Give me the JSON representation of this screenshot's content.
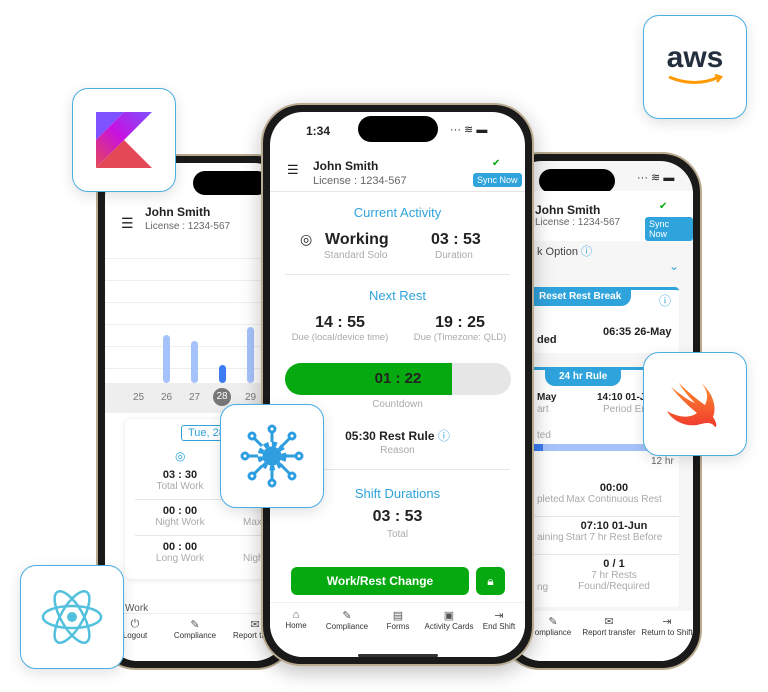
{
  "status": {
    "time": "1:34"
  },
  "user": {
    "name": "John Smith",
    "license": "License : 1234-567",
    "sync_label": "Sync Now"
  },
  "center": {
    "current_activity_title": "Current Activity",
    "activity": "Working",
    "activity_sub": "Standard Solo",
    "duration": "03 : 53",
    "duration_label": "Duration",
    "next_rest_title": "Next Rest",
    "due_local": "14 : 55",
    "due_local_label": "Due (local/device time)",
    "due_tz": "19 : 25",
    "due_tz_label": "Due (Timezone: QLD)",
    "countdown": "01 : 22",
    "countdown_label": "Countdown",
    "countdown_progress_percent": 74,
    "rule": "05:30 Rest Rule",
    "rule_label": "Reason",
    "shift_title": "Shift Durations",
    "shift_total": "03 : 53",
    "shift_total_label": "Total",
    "change_button": "Work/Rest Change",
    "tabs": [
      {
        "label": "Home",
        "icon": "home-icon"
      },
      {
        "label": "Compliance",
        "icon": "compliance-icon"
      },
      {
        "label": "Forms",
        "icon": "forms-icon"
      },
      {
        "label": "Activity Cards",
        "icon": "activity-cards-icon"
      },
      {
        "label": "End Shift",
        "icon": "end-shift-icon"
      }
    ]
  },
  "left": {
    "dates": [
      "25",
      "26",
      "27",
      "28",
      "29"
    ],
    "selected_date": "28",
    "bar_values": [
      0,
      0.7,
      0.65,
      0.25,
      0.75
    ],
    "date_chip": "Tue, 28 I",
    "stats": [
      {
        "value": "03 : 30",
        "label": "Total Work"
      },
      {
        "value": "00 : 00",
        "label": "Night Work"
      },
      {
        "value": "00 : 00",
        "label": "Long Work"
      }
    ],
    "stats_right": [
      "1(",
      "Max N",
      "Night I"
    ],
    "partial_row": "Work",
    "tabs": [
      {
        "label": "Logout",
        "icon": "power-icon"
      },
      {
        "label": "Compliance",
        "icon": "compliance-icon"
      },
      {
        "label": "Report trans",
        "icon": "mail-icon"
      }
    ]
  },
  "right": {
    "work_option": "k Option",
    "banner1": "Reset Rest Break",
    "b1_left": "ded",
    "b1_right": "06:35 26-May",
    "banner2": "24 hr Rule",
    "b2_left1": "May",
    "b2_left2": "art",
    "b2_right1": "14:10 01-Ju",
    "b2_right2": "Period End",
    "progress_label": "ted",
    "progress_end": "12 hr",
    "rows": [
      {
        "left": "pleted",
        "value": "00:00",
        "label": "Max Continuous Rest"
      },
      {
        "left": "aining",
        "value": "07:10 01-Jun",
        "label": "Start 7 hr Rest Before"
      },
      {
        "left": "ng",
        "value": "0 / 1",
        "label": "7 hr Rests",
        "label2": "Found/Required"
      }
    ],
    "tabs": [
      {
        "label": "ompliance",
        "icon": "compliance-icon"
      },
      {
        "label": "Report transfer",
        "icon": "mail-icon"
      },
      {
        "label": "Return to Shift",
        "icon": "return-icon"
      }
    ]
  },
  "logos": {
    "aws": "aws"
  },
  "colors": {
    "accent": "#2fa3dc",
    "green": "#06a90f",
    "bar": "#a6c2fb",
    "bar_selected": "#3d7cf2"
  }
}
